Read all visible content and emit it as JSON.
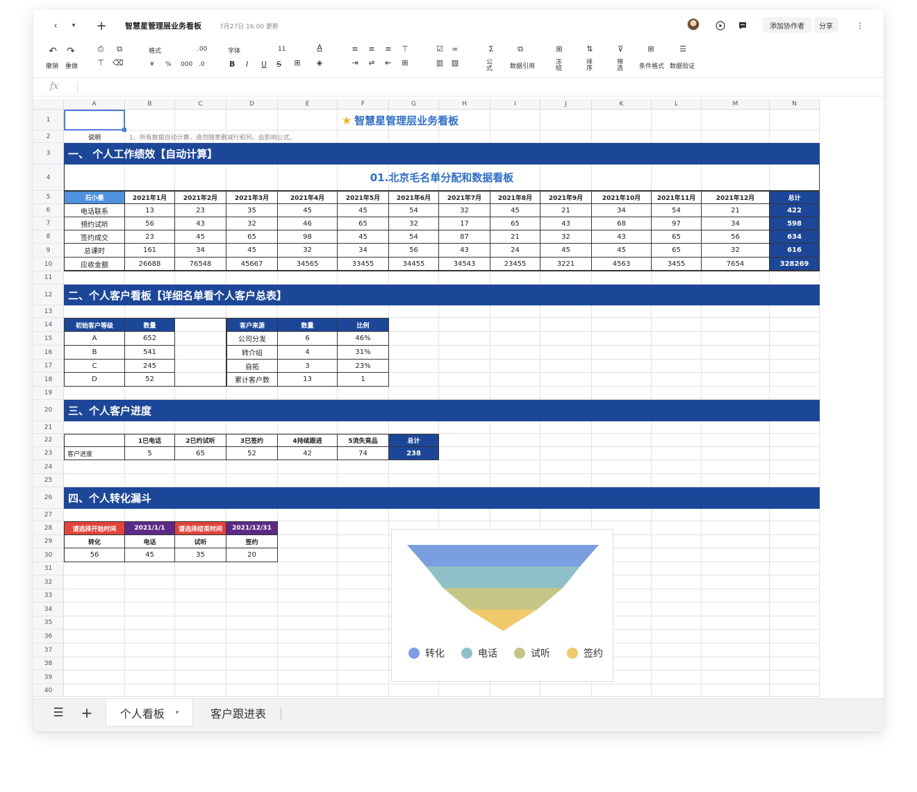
{
  "titlebar": {
    "doc_title": "智慧星管理层业务看板",
    "updated": "7月27日 16:00 更新",
    "add_collab": "添加协作者",
    "share": "分享"
  },
  "toolbar": {
    "undo": "撤销",
    "redo": "重做",
    "format": "格式",
    "font": "字体",
    "font_size": "11",
    "decimal": ".00",
    "currency": "¥",
    "percent": "%",
    "thousands": "000",
    "decimal_dec": ".0",
    "bold": "B",
    "italic": "I",
    "underline": "U",
    "strike": "S",
    "formula": "公式",
    "data_ref": "数据引用",
    "freeze": "冻结",
    "sort": "排序",
    "filter": "筛选",
    "cond_format": "条件格式",
    "data_validate": "数据验证"
  },
  "formula_bar": {
    "fx": "fx"
  },
  "columns": [
    "A",
    "B",
    "C",
    "D",
    "E",
    "F",
    "G",
    "H",
    "I",
    "J",
    "K",
    "L",
    "M",
    "N"
  ],
  "rows": [
    "1",
    "2",
    "3",
    "4",
    "5",
    "6",
    "7",
    "8",
    "9",
    "10",
    "11",
    "12",
    "13",
    "14",
    "15",
    "16",
    "17",
    "18",
    "19",
    "20",
    "21",
    "22",
    "23",
    "24",
    "25",
    "26",
    "27",
    "28",
    "29",
    "30",
    "31",
    "32",
    "33",
    "34",
    "35",
    "36",
    "37",
    "38",
    "39",
    "40"
  ],
  "sheet": {
    "main_title": "智慧星管理层业务看板",
    "note_label": "说明",
    "note_text": "1、所有数据自动计算，请勿随意删减行和列，会影响公式。",
    "section1": "一、 个人工作绩效【自动计算】",
    "board_title": "01.北京毛名单分配和数据看板",
    "perf_header": [
      "石小墨",
      "2021年1月",
      "2021年2月",
      "2021年3月",
      "2021年4月",
      "2021年5月",
      "2021年6月",
      "2021年7月",
      "2021年8月",
      "2021年9月",
      "2021年10月",
      "2021年11月",
      "2021年12月",
      "总计"
    ],
    "perf_rows": [
      [
        "电话联系",
        "13",
        "23",
        "35",
        "45",
        "45",
        "54",
        "32",
        "45",
        "21",
        "34",
        "54",
        "21",
        "422"
      ],
      [
        "预约试听",
        "56",
        "43",
        "32",
        "46",
        "65",
        "32",
        "17",
        "65",
        "43",
        "68",
        "97",
        "34",
        "598"
      ],
      [
        "签约成交",
        "23",
        "45",
        "65",
        "98",
        "45",
        "54",
        "87",
        "21",
        "32",
        "43",
        "65",
        "56",
        "634"
      ],
      [
        "总课时",
        "161",
        "34",
        "45",
        "32",
        "34",
        "56",
        "43",
        "24",
        "45",
        "45",
        "65",
        "32",
        "616"
      ],
      [
        "应收金额",
        "26688",
        "76548",
        "45667",
        "34565",
        "33455",
        "34455",
        "34543",
        "23455",
        "3221",
        "4563",
        "3455",
        "7654",
        "328269"
      ]
    ],
    "section2": "二、个人客户看板【详细名单看个人客户总表】",
    "level_table": {
      "header": [
        "初始客户等级",
        "数量"
      ],
      "rows": [
        [
          "A",
          "652"
        ],
        [
          "B",
          "541"
        ],
        [
          "C",
          "245"
        ],
        [
          "D",
          "52"
        ]
      ]
    },
    "source_table": {
      "header": [
        "客户来源",
        "数量",
        "比例"
      ],
      "rows": [
        [
          "公司分发",
          "6",
          "46%"
        ],
        [
          "转介绍",
          "4",
          "31%"
        ],
        [
          "自拓",
          "3",
          "23%"
        ],
        [
          "累计客户数",
          "13",
          "1"
        ]
      ]
    },
    "section3": "三、个人客户进度",
    "progress_header": [
      "",
      "1已电话",
      "2已约试听",
      "3已签约",
      "4持续跟进",
      "5流失竟品",
      "总计"
    ],
    "progress_row": [
      "客户进度",
      "5",
      "65",
      "52",
      "42",
      "74",
      "238"
    ],
    "section4": "四、个人转化漏斗",
    "funnel_table": {
      "row28": [
        "请选择开始时间",
        "2021/1/1",
        "请选择结束时间",
        "2021/12/31"
      ],
      "header": [
        "转化",
        "电话",
        "试听",
        "签约"
      ],
      "values": [
        "56",
        "45",
        "35",
        "20"
      ]
    }
  },
  "chart_data": {
    "type": "funnel",
    "categories": [
      "转化",
      "电话",
      "试听",
      "签约"
    ],
    "values": [
      56,
      45,
      35,
      20
    ],
    "colors": [
      "#7b9ee0",
      "#8fc0c8",
      "#c5c585",
      "#f0ca6a"
    ],
    "legend_position": "bottom"
  },
  "tabs": {
    "active": "个人看板",
    "other": "客户跟进表"
  },
  "colors": {
    "navy": "#1c4799",
    "accent_blue": "#2f6fc9",
    "header_light": "#4f92e0",
    "red": "#e2443a",
    "purple": "#5b2a86"
  }
}
